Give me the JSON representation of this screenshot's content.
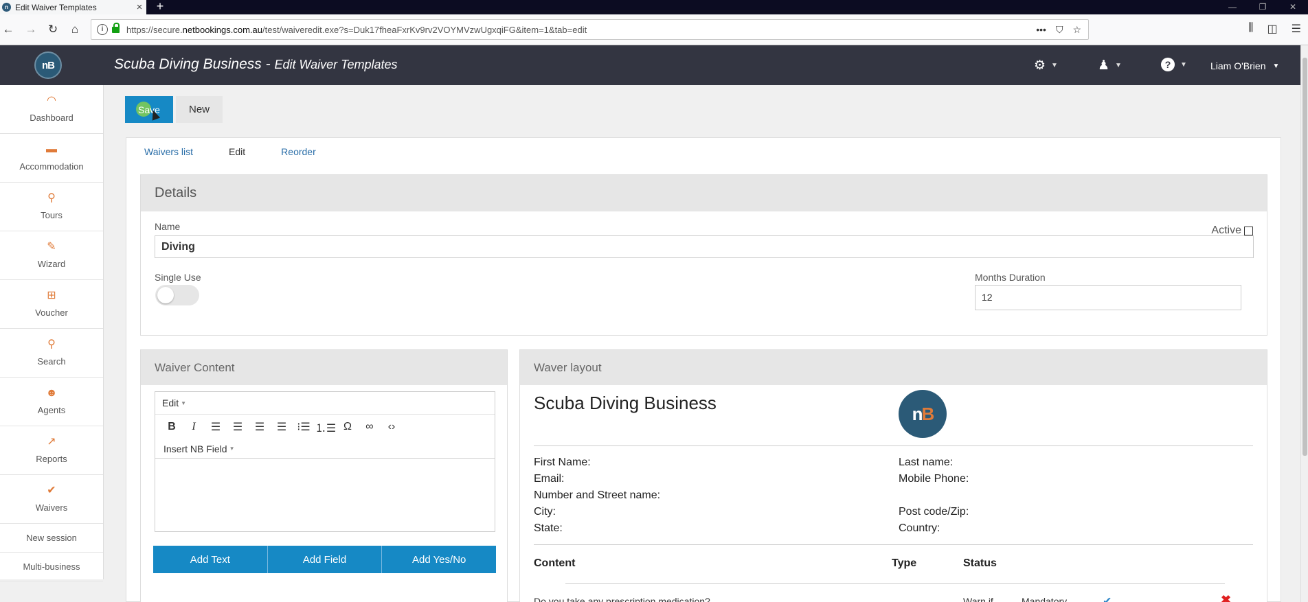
{
  "browser": {
    "tab_title": "Edit Waiver Templates",
    "url_prefix": "https://secure.",
    "url_host": "netbookings.com.au",
    "url_rest": "/test/waiveredit.exe?s=Duk17fheaFxrKv9rv2VOYMVzwUgxqiFG&item=1&tab=edit"
  },
  "header": {
    "logo_text": "nB",
    "business": "Scuba Diving Business",
    "separator": " - ",
    "page_title": "Edit Waiver Templates",
    "user_name": "Liam O'Brien"
  },
  "sidebar": {
    "items": [
      {
        "label": "Dashboard",
        "icon": "dashboard-icon",
        "glyph": "◠"
      },
      {
        "label": "Accommodation",
        "icon": "bed-icon",
        "glyph": "▬"
      },
      {
        "label": "Tours",
        "icon": "tours-icon",
        "glyph": "⚲"
      },
      {
        "label": "Wizard",
        "icon": "wand-icon",
        "glyph": "✎"
      },
      {
        "label": "Voucher",
        "icon": "gift-icon",
        "glyph": "⊞"
      },
      {
        "label": "Search",
        "icon": "search-icon",
        "glyph": "⚲"
      },
      {
        "label": "Agents",
        "icon": "agent-icon",
        "glyph": "☻"
      },
      {
        "label": "Reports",
        "icon": "chart-icon",
        "glyph": "↗"
      },
      {
        "label": "Waivers",
        "icon": "check-icon",
        "glyph": "✔"
      }
    ],
    "links": [
      "New session",
      "Multi-business"
    ]
  },
  "actions": {
    "save": "Save",
    "new": "New"
  },
  "tabs": [
    "Waivers list",
    "Edit",
    "Reorder"
  ],
  "details": {
    "title": "Details",
    "name_label": "Name",
    "name_value": "Diving",
    "active_label": "Active",
    "single_use_label": "Single Use",
    "months_label": "Months Duration",
    "months_value": "12"
  },
  "waiver_content": {
    "title": "Waiver Content",
    "menu_edit": "Edit",
    "insert_field": "Insert NB Field",
    "buttons": [
      "Add Text",
      "Add Field",
      "Add Yes/No"
    ]
  },
  "layout": {
    "title": "Waver layout",
    "business": "Scuba Diving Business",
    "left_fields": [
      "First Name:",
      "Email:",
      "Number and Street name:",
      "City:",
      "State:"
    ],
    "right_fields": [
      "Last name:",
      "Mobile Phone:",
      "",
      "Post code/Zip:",
      "Country:"
    ],
    "columns": [
      "Content",
      "Type",
      "Status"
    ],
    "row": {
      "content": "Do you take any prescription medication?",
      "type": "Warn if",
      "status": "Mandatory"
    }
  },
  "colors": {
    "accent": "#1689c5",
    "header": "#333541",
    "icon_orange": "#e07b39"
  }
}
